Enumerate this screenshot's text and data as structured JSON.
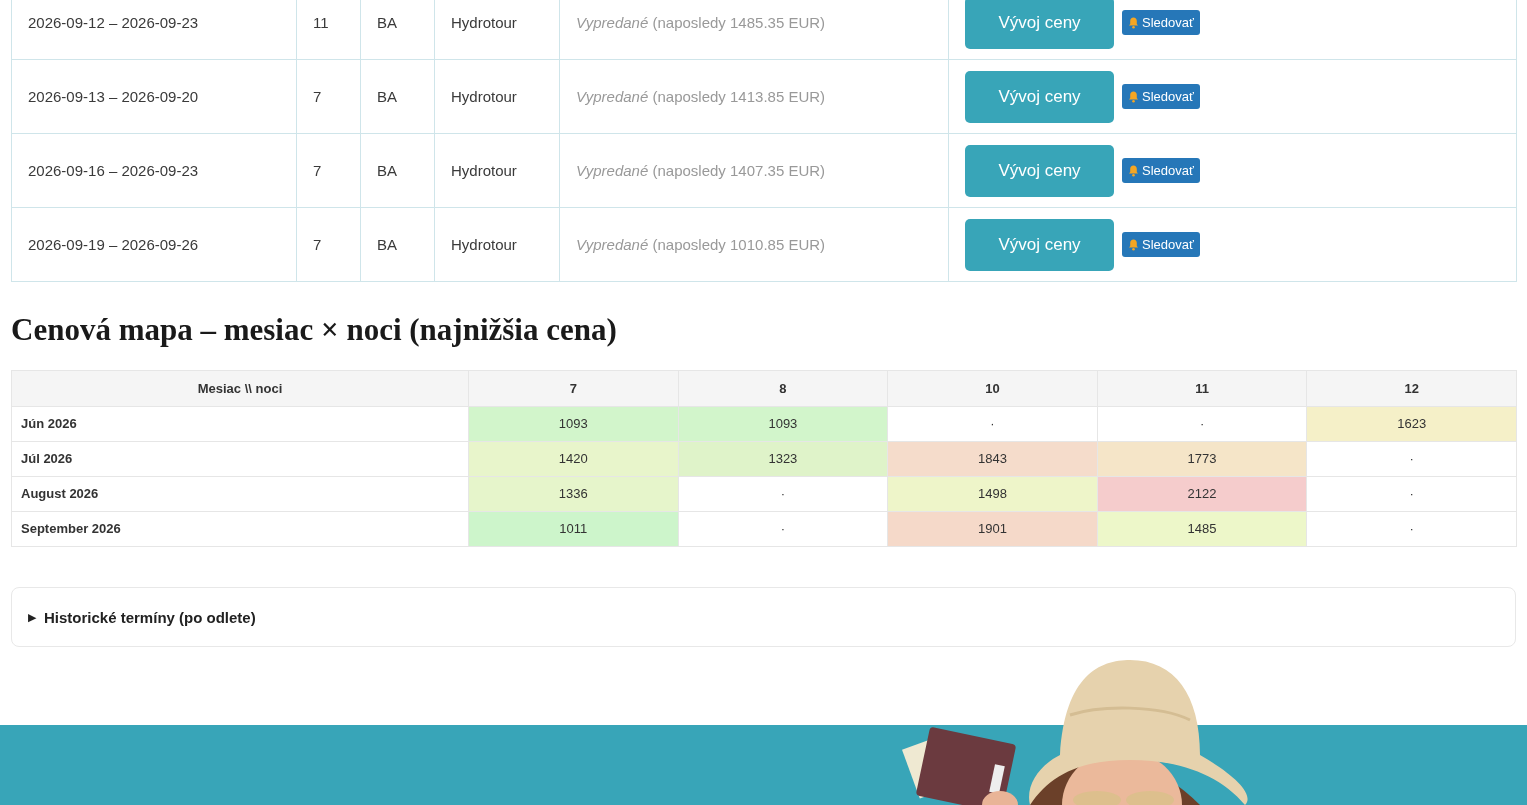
{
  "departures": [
    {
      "dates": "2026-09-12 – 2026-09-23",
      "nights": "11",
      "airport": "BA",
      "operator": "Hydrotour",
      "status": "Vypredané",
      "note": "(naposledy 1485.35 EUR)",
      "price_button": "Vývoj ceny",
      "watch_button": "Sledovať"
    },
    {
      "dates": "2026-09-13 – 2026-09-20",
      "nights": "7",
      "airport": "BA",
      "operator": "Hydrotour",
      "status": "Vypredané",
      "note": "(naposledy 1413.85 EUR)",
      "price_button": "Vývoj ceny",
      "watch_button": "Sledovať"
    },
    {
      "dates": "2026-09-16 – 2026-09-23",
      "nights": "7",
      "airport": "BA",
      "operator": "Hydrotour",
      "status": "Vypredané",
      "note": "(naposledy 1407.35 EUR)",
      "price_button": "Vývoj ceny",
      "watch_button": "Sledovať"
    },
    {
      "dates": "2026-09-19 – 2026-09-26",
      "nights": "7",
      "airport": "BA",
      "operator": "Hydrotour",
      "status": "Vypredané",
      "note": "(naposledy 1010.85 EUR)",
      "price_button": "Vývoj ceny",
      "watch_button": "Sledovať"
    }
  ],
  "price_map": {
    "title": "Cenová mapa – mesiac × noci (najnižšia cena)",
    "corner_header": "Mesiac \\\\ noci",
    "columns": [
      "7",
      "8",
      "10",
      "11",
      "12"
    ],
    "rows": [
      {
        "month": "Jún 2026",
        "cells": [
          {
            "text": "1093",
            "color": "#d2f5cb"
          },
          {
            "text": "1093",
            "color": "#d2f5cb"
          },
          {
            "text": "·"
          },
          {
            "text": "·"
          },
          {
            "text": "1623",
            "color": "#f5f0c8"
          }
        ]
      },
      {
        "month": "Júl 2026",
        "cells": [
          {
            "text": "1420",
            "color": "#e8f5cb"
          },
          {
            "text": "1323",
            "color": "#dff3c9"
          },
          {
            "text": "1843",
            "color": "#f5dccb"
          },
          {
            "text": "1773",
            "color": "#f5e5c8"
          },
          {
            "text": "·"
          }
        ]
      },
      {
        "month": "August 2026",
        "cells": [
          {
            "text": "1336",
            "color": "#e6f5cb"
          },
          {
            "text": "·"
          },
          {
            "text": "1498",
            "color": "#eef5c9"
          },
          {
            "text": "2122",
            "color": "#f5cccc"
          },
          {
            "text": "·"
          }
        ]
      },
      {
        "month": "September 2026",
        "cells": [
          {
            "text": "1011",
            "color": "#cdf5cb"
          },
          {
            "text": "·"
          },
          {
            "text": "1901",
            "color": "#f5d9c9"
          },
          {
            "text": "1485",
            "color": "#edf7c9"
          },
          {
            "text": "·"
          }
        ]
      }
    ]
  },
  "history": {
    "marker": "▶",
    "label": "Historické termíny (po odlete)"
  }
}
